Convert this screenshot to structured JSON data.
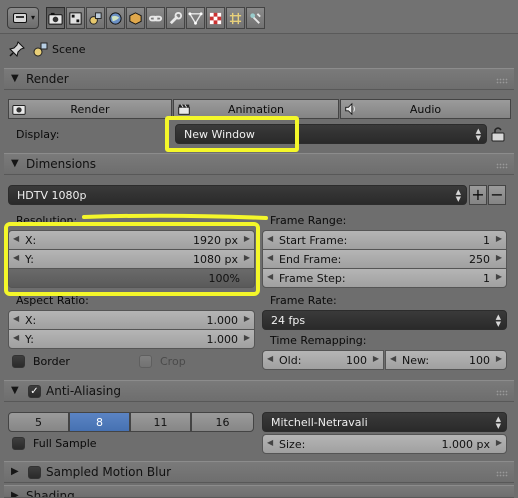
{
  "context_tabs": [
    {
      "name": "render",
      "active": true
    },
    {
      "name": "render-layers"
    },
    {
      "name": "scene"
    },
    {
      "name": "world"
    },
    {
      "name": "object"
    },
    {
      "name": "constraints"
    },
    {
      "name": "modifiers"
    },
    {
      "name": "data"
    },
    {
      "name": "material"
    },
    {
      "name": "texture"
    },
    {
      "name": "particles"
    },
    {
      "name": "physics"
    }
  ],
  "breadcrumb": {
    "scene": "Scene"
  },
  "render_panel": {
    "title": "Render",
    "buttons": {
      "render": "Render",
      "animation": "Animation",
      "audio": "Audio"
    },
    "display_label": "Display:",
    "display_value": "New Window"
  },
  "dimensions_panel": {
    "title": "Dimensions",
    "preset": "HDTV 1080p",
    "resolution_label": "Resolution:",
    "res_x": {
      "label": "X:",
      "value": "1920 px"
    },
    "res_y": {
      "label": "Y:",
      "value": "1080 px"
    },
    "res_pct": "100%",
    "aspect_label": "Aspect Ratio:",
    "aspect_x": {
      "label": "X:",
      "value": "1.000"
    },
    "aspect_y": {
      "label": "Y:",
      "value": "1.000"
    },
    "border_label": "Border",
    "crop_label": "Crop",
    "frame_range_label": "Frame Range:",
    "start_frame": {
      "label": "Start Frame:",
      "value": "1"
    },
    "end_frame": {
      "label": "End Frame:",
      "value": "250"
    },
    "frame_step": {
      "label": "Frame Step:",
      "value": "1"
    },
    "frame_rate_label": "Frame Rate:",
    "frame_rate": "24 fps",
    "time_remap_label": "Time Remapping:",
    "remap_old": {
      "label": "Old:",
      "value": "100"
    },
    "remap_new": {
      "label": "New:",
      "value": "100"
    }
  },
  "aa_panel": {
    "title": "Anti-Aliasing",
    "enabled": true,
    "samples": [
      "5",
      "8",
      "11",
      "16"
    ],
    "selected_sample": "8",
    "filter": "Mitchell-Netravali",
    "full_sample_label": "Full Sample",
    "size": {
      "label": "Size:",
      "value": "1.000 px"
    }
  },
  "motion_blur_panel": {
    "title": "Sampled Motion Blur"
  },
  "shading_panel": {
    "title": "Shading"
  },
  "colors": {
    "highlight": "#f4f72a",
    "selected_segment": "#5b84c4",
    "background": "#6e6e6e"
  }
}
